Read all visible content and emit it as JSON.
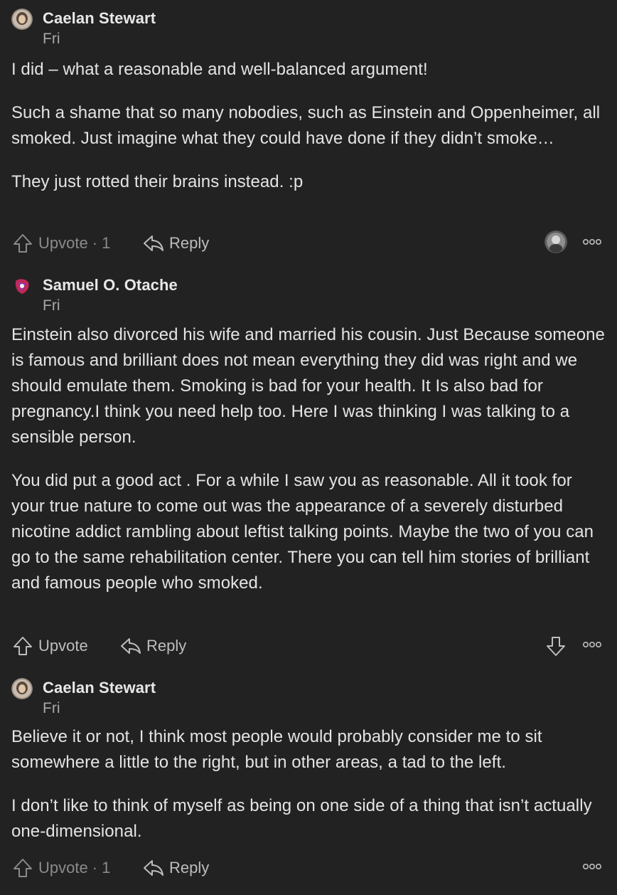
{
  "comments": [
    {
      "author": "Caelan Stewart",
      "date": "Fri",
      "paragraphs": [
        "I did – what a reasonable and well-balanced argument!",
        "Such a shame that so many nobodies, such as Einstein and Oppenheimer, all smoked. Just imagine what they could have done if they didn’t smoke…",
        "They just rotted their brains instead. :p"
      ],
      "upvote_label": "Upvote",
      "upvote_count": "· 1",
      "reply_label": "Reply"
    },
    {
      "author": "Samuel O. Otache",
      "date": "Fri",
      "paragraphs": [
        "Einstein also divorced his wife and married his cousin. Just Because someone is famous and brilliant does not mean everything they did was right and we should emulate them. Smoking is bad for your health. It Is also bad for pregnancy.I think you need help too. Here I was thinking I was talking to a sensible person.",
        "You did put a good act . For a while I saw you as reasonable. All it took for your true nature to come out was the appearance of a severely disturbed nicotine addict rambling about leftist talking points. Maybe the two of you can go to the same rehabilitation center. There you can tell him stories of brilliant and famous people who smoked."
      ],
      "upvote_label": "Upvote",
      "reply_label": "Reply"
    },
    {
      "author": "Caelan Stewart",
      "date": "Fri",
      "paragraphs": [
        "Believe it or not, I think most people would probably consider me to sit somewhere a little to the right, but in other areas, a tad to the left.",
        "I don’t like to think of myself as being on one side of a thing that isn’t actually one-dimensional."
      ],
      "upvote_label": "Upvote",
      "upvote_count": "· 1",
      "reply_label": "Reply"
    }
  ],
  "icons": {
    "upvote": "upvote-arrow-icon",
    "downvote": "downvote-arrow-icon",
    "reply": "reply-arrow-icon",
    "more": "more-options-icon"
  },
  "colors": {
    "background": "#222222",
    "text": "#e4e4e4",
    "muted": "#a8a8a8"
  }
}
